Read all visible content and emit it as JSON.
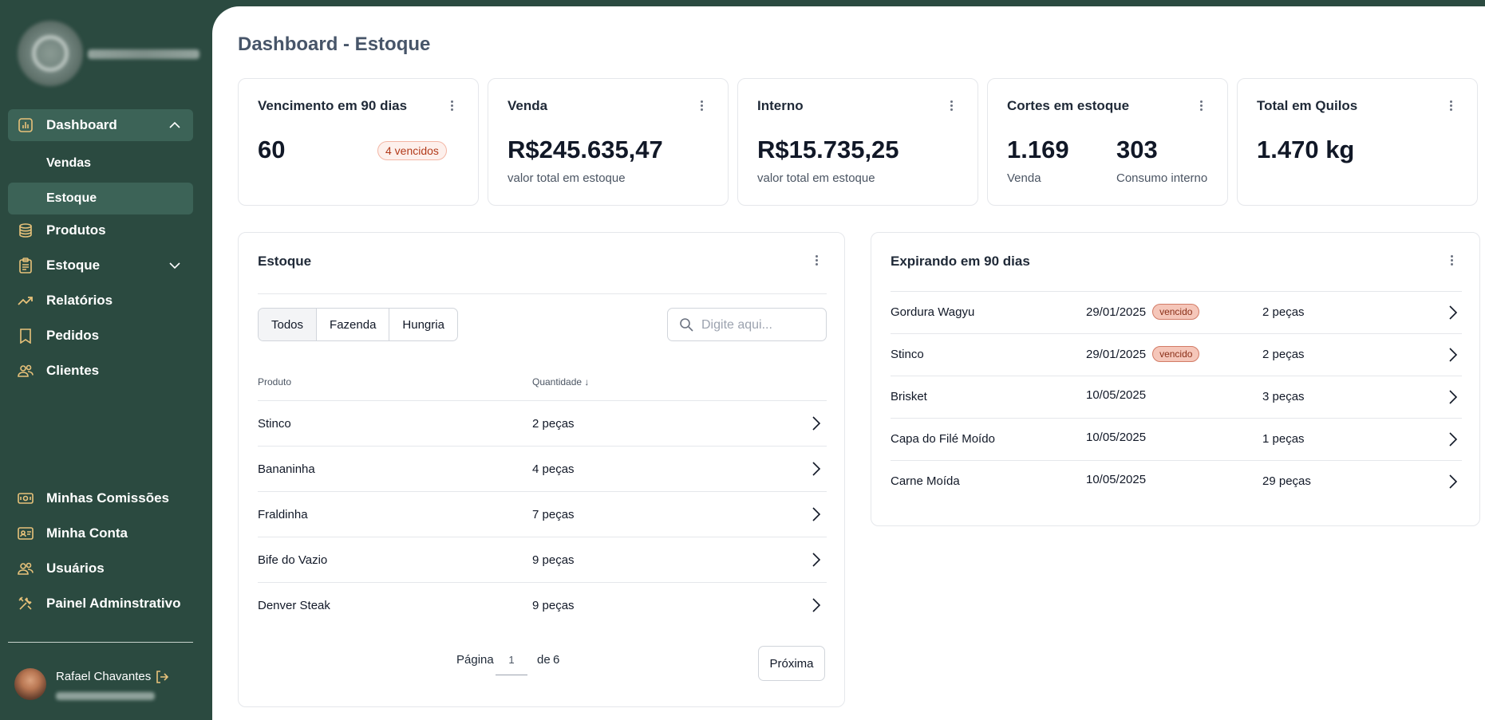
{
  "sidebar": {
    "nav": [
      {
        "label": "Dashboard",
        "icon": "bar-chart-icon",
        "expanded": true
      },
      {
        "label": "Vendas"
      },
      {
        "label": "Estoque"
      },
      {
        "label": "Produtos",
        "icon": "database-icon"
      },
      {
        "label": "Estoque",
        "icon": "clipboard-icon",
        "expanded": false
      },
      {
        "label": "Relatórios",
        "icon": "trend-up-icon"
      },
      {
        "label": "Pedidos",
        "icon": "bookmark-icon"
      },
      {
        "label": "Clientes",
        "icon": "users-icon"
      }
    ],
    "bottom_nav": [
      {
        "label": "Minhas Comissões",
        "icon": "banknote-icon"
      },
      {
        "label": "Minha Conta",
        "icon": "id-card-icon"
      },
      {
        "label": "Usuários",
        "icon": "users-icon"
      },
      {
        "label": "Painel Adminstrativo",
        "icon": "tools-icon"
      }
    ],
    "user": {
      "name": "Rafael Chavantes"
    }
  },
  "main": {
    "title": "Dashboard - Estoque",
    "stats": [
      {
        "title": "Vencimento em 90 dias",
        "value": "60",
        "badge": "4 vencidos"
      },
      {
        "title": "Venda",
        "value": "R$245.635,47",
        "sub": "valor total em estoque"
      },
      {
        "title": "Interno",
        "value": "R$15.735,25",
        "sub": "valor total em estoque"
      },
      {
        "title": "Cortes em estoque",
        "value": "1.169",
        "sub": "Venda",
        "value2": "303",
        "sub2": "Consumo interno"
      },
      {
        "title": "Total em Quilos",
        "value": "1.470 kg"
      }
    ],
    "stock": {
      "title": "Estoque",
      "filters": [
        "Todos",
        "Fazenda",
        "Hungria"
      ],
      "active_filter": "Todos",
      "search_placeholder": "Digite aqui...",
      "columns": [
        "Produto",
        "Quantidade"
      ],
      "sort_indicator": "↓",
      "rows": [
        {
          "product": "Stinco",
          "qty": "2 peças"
        },
        {
          "product": "Bananinha",
          "qty": "4 peças"
        },
        {
          "product": "Fraldinha",
          "qty": "7 peças"
        },
        {
          "product": "Bife do Vazio",
          "qty": "9 peças"
        },
        {
          "product": "Denver Steak",
          "qty": "9 peças"
        }
      ],
      "pager": {
        "label": "Página",
        "page": "1",
        "of": "de",
        "total": "6",
        "next": "Próxima"
      }
    },
    "expiring": {
      "title": "Expirando em 90 dias",
      "rows": [
        {
          "product": "Gordura Wagyu",
          "date": "29/01/2025",
          "badge": "vencido",
          "qty": "2 peças"
        },
        {
          "product": "Stinco",
          "date": "29/01/2025",
          "badge": "vencido",
          "qty": "2 peças"
        },
        {
          "product": "Brisket",
          "date": "10/05/2025",
          "badge": "",
          "qty": "3 peças"
        },
        {
          "product": "Capa do Filé Moído",
          "date": "10/05/2025",
          "badge": "",
          "qty": "1 peças"
        },
        {
          "product": "Carne Moída",
          "date": "10/05/2025",
          "badge": "",
          "qty": "29 peças"
        }
      ]
    }
  },
  "colors": {
    "sidebar_bg": "#2b4a40",
    "active_bg": "#3c6357",
    "badge_red": "#b23a1a",
    "icon_gold": "#e8c27a"
  }
}
